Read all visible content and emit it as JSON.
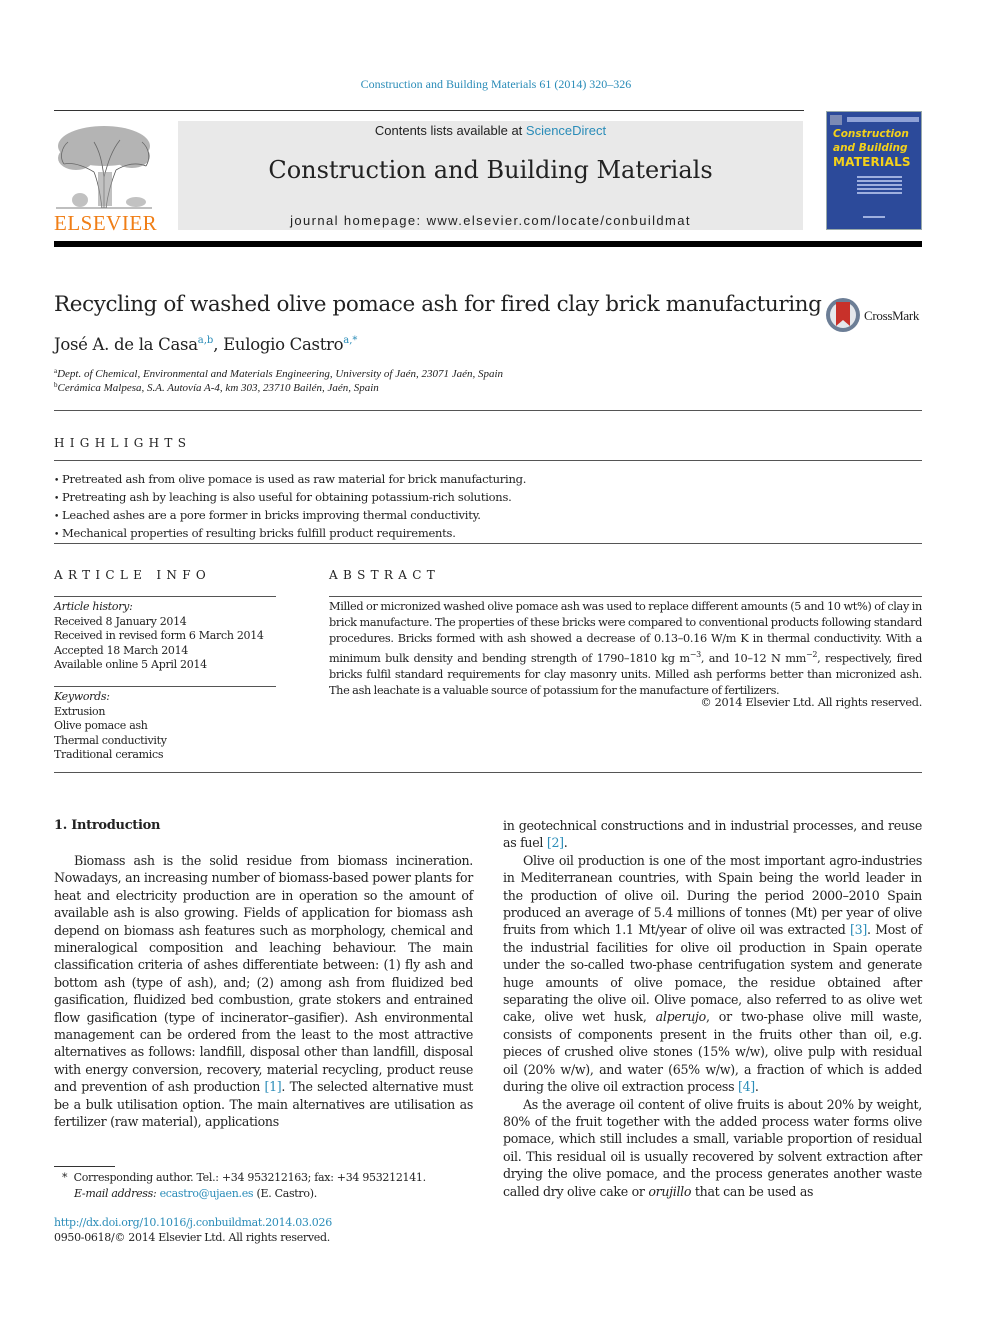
{
  "journal_ref": "Construction and Building Materials 61 (2014) 320–326",
  "masthead": {
    "contents_prefix": "Contents lists available at ",
    "contents_link": "ScienceDirect",
    "journal_name": "Construction and Building Materials",
    "homepage_prefix": "journal homepage: ",
    "homepage_url": "www.elsevier.com/locate/conbuildmat",
    "publisher": "ELSEVIER",
    "cover_title_line1": "Construction",
    "cover_title_line2": "and Building",
    "cover_title_line3": "MATERIALS"
  },
  "article": {
    "title": "Recycling of washed olive pomace ash for fired clay brick manufacturing",
    "crossmark_label": "CrossMark",
    "authors": [
      {
        "name": "José A. de la Casa",
        "sup": "a,b",
        "sep": ", "
      },
      {
        "name": "Eulogio Castro",
        "sup": "a,*",
        "sep": ""
      }
    ],
    "affiliations": [
      {
        "mark": "a",
        "text": "Dept. of Chemical, Environmental and Materials Engineering, University of Jaén, 23071 Jaén, Spain"
      },
      {
        "mark": "b",
        "text": "Cerámica Malpesa, S.A. Autovía A-4, km 303, 23710 Bailén, Jaén, Spain"
      }
    ]
  },
  "highlights": {
    "heading": "HIGHLIGHTS",
    "bullet": "•",
    "items": [
      "Pretreated ash from olive pomace is used as raw material for brick manufacturing.",
      "Pretreating ash by leaching is also useful for obtaining potassium-rich solutions.",
      "Leached ashes are a pore former in bricks improving thermal conductivity.",
      "Mechanical properties of resulting bricks fulfill product requirements."
    ]
  },
  "article_info": {
    "heading": "ARTICLE INFO",
    "history_label": "Article history:",
    "history": [
      "Received 8 January 2014",
      "Received in revised form 6 March 2014",
      "Accepted 18 March 2014",
      "Available online 5 April 2014"
    ],
    "keywords_label": "Keywords:",
    "keywords": [
      "Extrusion",
      "Olive pomace ash",
      "Thermal conductivity",
      "Traditional ceramics"
    ]
  },
  "abstract": {
    "heading": "ABSTRACT",
    "part1": "Milled or micronized washed olive pomace ash was used to replace different amounts (5 and 10 wt%) of clay in brick manufacture. The properties of these bricks were compared to conventional products following standard procedures. Bricks formed with ash showed a decrease of 0.13–0.16 W/m K in thermal conductivity. With a minimum bulk density and bending strength of 1790–1810 kg m",
    "sup1": "−3",
    "part2": ", and 10–12 N mm",
    "sup2": "−2",
    "part3": ", respectively, fired bricks fulfil standard requirements for clay masonry units. Milled ash performs better than micronized ash. The ash leachate is a valuable source of potassium for the manufacture of fertilizers.",
    "copyright": "© 2014 Elsevier Ltd. All rights reserved."
  },
  "introduction": {
    "heading": "1. Introduction",
    "left_p1a": "Biomass ash is the solid residue from biomass incineration. Nowadays, an increasing number of biomass-based power plants for heat and electricity production are in operation so the amount of available ash is also growing. Fields of application for biomass ash depend on biomass ash features such as morphology, chemical and mineralogical composition and leaching behaviour. The main classification criteria of ashes differentiate between: (1) fly ash and bottom ash (type of ash), and; (2) among ash from fluidized bed gasification, fluidized bed combustion, grate stokers and entrained flow gasification (type of incinerator–gasifier). Ash environmental management can be ordered from the least to the most attractive alternatives as follows: landfill, disposal other than landfill, disposal with energy conversion, recovery, material recycling, product reuse and prevention of ash production ",
    "ref1": "[1]",
    "left_p1b": ". The selected alternative must be a bulk utilisation option. The main alternatives are utilisation as fertilizer (raw material), applications",
    "right_p0a": "in geotechnical constructions and in industrial processes, and reuse as fuel ",
    "ref2": "[2]",
    "right_p0b": ".",
    "right_p1a": "Olive oil production is one of the most important agro-industries in Mediterranean countries, with Spain being the world leader in the production of olive oil. During the period 2000–2010 Spain produced an average of 5.4 millions of tonnes (Mt) per year of olive fruits from which 1.1 Mt/year of olive oil was extracted ",
    "ref3": "[3]",
    "right_p1b": ". Most of the industrial facilities for olive oil production in Spain operate under the so-called two-phase centrifugation system and generate huge amounts of olive pomace, the residue obtained after separating the olive oil. Olive pomace, also referred to as olive wet cake, olive wet husk, ",
    "right_p1_italic": "alperujo",
    "right_p1c": ", or two-phase olive mill waste, consists of components present in the fruits other than oil, e.g. pieces of crushed olive stones (15% w/w), olive pulp with residual oil (20% w/w), and water (65% w/w), a fraction of which is added during the olive oil extraction process ",
    "ref4": "[4]",
    "right_p1d": ".",
    "right_p2a": "As the average oil content of olive fruits is about 20% by weight, 80% of the fruit together with the added process water forms olive pomace, which still includes a small, variable proportion of residual oil. This residual oil is usually recovered by solvent extraction after drying the olive pomace, and the process generates another waste called dry olive cake or ",
    "right_p2_italic": "orujillo",
    "right_p2b": " that can be used as"
  },
  "footnotes": {
    "star": "*",
    "corresponding": "Corresponding author. Tel.: +34 953212163; fax: +34 953212141.",
    "email_label": "E-mail address:",
    "email": "ecastro@ujaen.es",
    "email_suffix": " (E. Castro).",
    "doi": "http://dx.doi.org/10.1016/j.conbuildmat.2014.03.026",
    "issn": "0950-0618/© 2014 Elsevier Ltd. All rights reserved."
  }
}
